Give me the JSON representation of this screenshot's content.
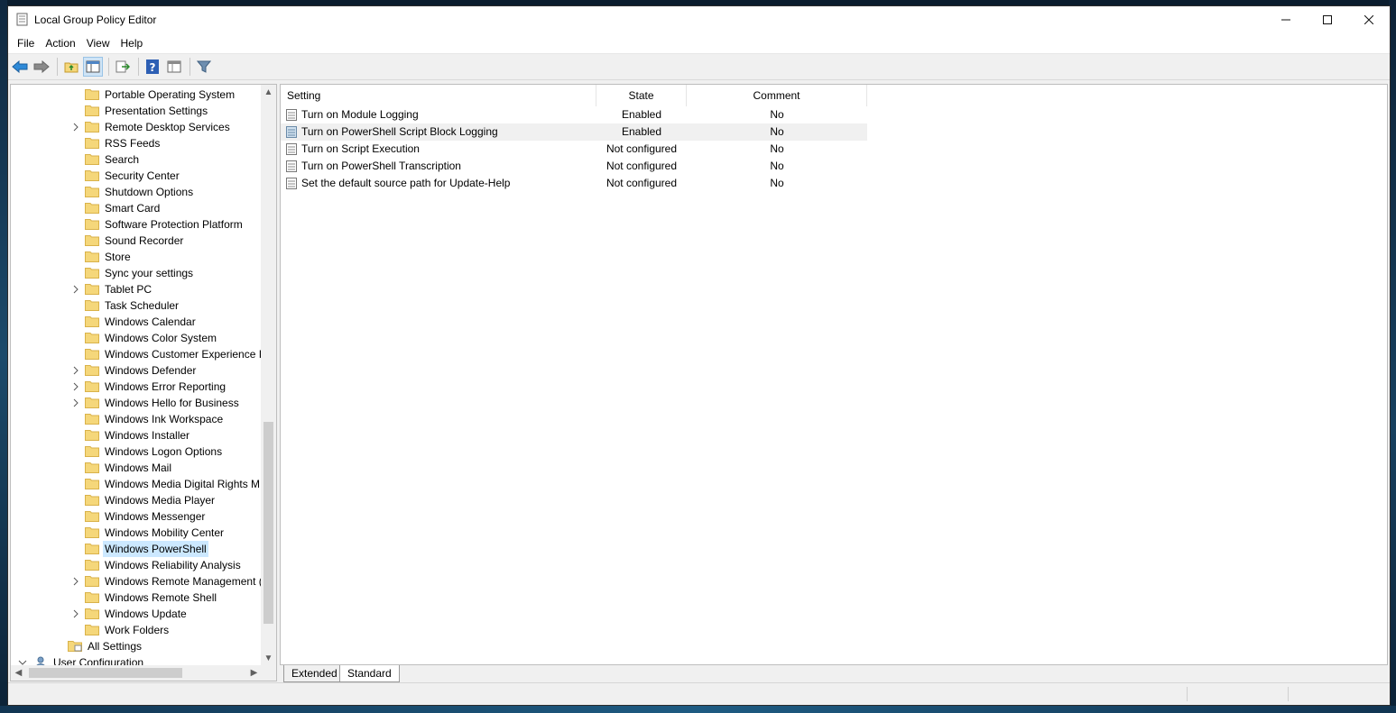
{
  "window": {
    "title": "Local Group Policy Editor"
  },
  "menu": [
    "File",
    "Action",
    "View",
    "Help"
  ],
  "toolbar": {
    "buttons": [
      "back-arrow-icon",
      "forward-arrow-icon",
      "up-folder-icon",
      "show-hide-tree-icon",
      "export-list-icon",
      "help-icon",
      "properties-icon",
      "filter-icon"
    ]
  },
  "tree": {
    "items": [
      {
        "label": "Portable Operating System",
        "expandable": false
      },
      {
        "label": "Presentation Settings",
        "expandable": false
      },
      {
        "label": "Remote Desktop Services",
        "expandable": true
      },
      {
        "label": "RSS Feeds",
        "expandable": false
      },
      {
        "label": "Search",
        "expandable": false
      },
      {
        "label": "Security Center",
        "expandable": false
      },
      {
        "label": "Shutdown Options",
        "expandable": false
      },
      {
        "label": "Smart Card",
        "expandable": false
      },
      {
        "label": "Software Protection Platform",
        "expandable": false
      },
      {
        "label": "Sound Recorder",
        "expandable": false
      },
      {
        "label": "Store",
        "expandable": false
      },
      {
        "label": "Sync your settings",
        "expandable": false
      },
      {
        "label": "Tablet PC",
        "expandable": true
      },
      {
        "label": "Task Scheduler",
        "expandable": false
      },
      {
        "label": "Windows Calendar",
        "expandable": false
      },
      {
        "label": "Windows Color System",
        "expandable": false
      },
      {
        "label": "Windows Customer Experience Ir",
        "expandable": false
      },
      {
        "label": "Windows Defender",
        "expandable": true
      },
      {
        "label": "Windows Error Reporting",
        "expandable": true
      },
      {
        "label": "Windows Hello for Business",
        "expandable": true
      },
      {
        "label": "Windows Ink Workspace",
        "expandable": false
      },
      {
        "label": "Windows Installer",
        "expandable": false
      },
      {
        "label": "Windows Logon Options",
        "expandable": false
      },
      {
        "label": "Windows Mail",
        "expandable": false
      },
      {
        "label": "Windows Media Digital Rights M",
        "expandable": false
      },
      {
        "label": "Windows Media Player",
        "expandable": false
      },
      {
        "label": "Windows Messenger",
        "expandable": false
      },
      {
        "label": "Windows Mobility Center",
        "expandable": false
      },
      {
        "label": "Windows PowerShell",
        "expandable": false,
        "selected": true
      },
      {
        "label": "Windows Reliability Analysis",
        "expandable": false
      },
      {
        "label": "Windows Remote Management (",
        "expandable": true
      },
      {
        "label": "Windows Remote Shell",
        "expandable": false
      },
      {
        "label": "Windows Update",
        "expandable": true
      },
      {
        "label": "Work Folders",
        "expandable": false
      }
    ],
    "all_settings": "All Settings",
    "user_configuration": "User Configuration"
  },
  "list": {
    "columns": {
      "setting": "Setting",
      "state": "State",
      "comment": "Comment"
    },
    "rows": [
      {
        "setting": "Turn on Module Logging",
        "state": "Enabled",
        "comment": "No"
      },
      {
        "setting": "Turn on PowerShell Script Block Logging",
        "state": "Enabled",
        "comment": "No",
        "highlighted": true
      },
      {
        "setting": "Turn on Script Execution",
        "state": "Not configured",
        "comment": "No"
      },
      {
        "setting": "Turn on PowerShell Transcription",
        "state": "Not configured",
        "comment": "No"
      },
      {
        "setting": "Set the default source path for Update-Help",
        "state": "Not configured",
        "comment": "No"
      }
    ]
  },
  "tabs": {
    "extended": "Extended",
    "standard": "Standard"
  },
  "colors": {
    "selection": "#cce8ff",
    "folder": "#f5d77a",
    "folder_edge": "#d9b24a",
    "accent": "#1e78c8"
  }
}
